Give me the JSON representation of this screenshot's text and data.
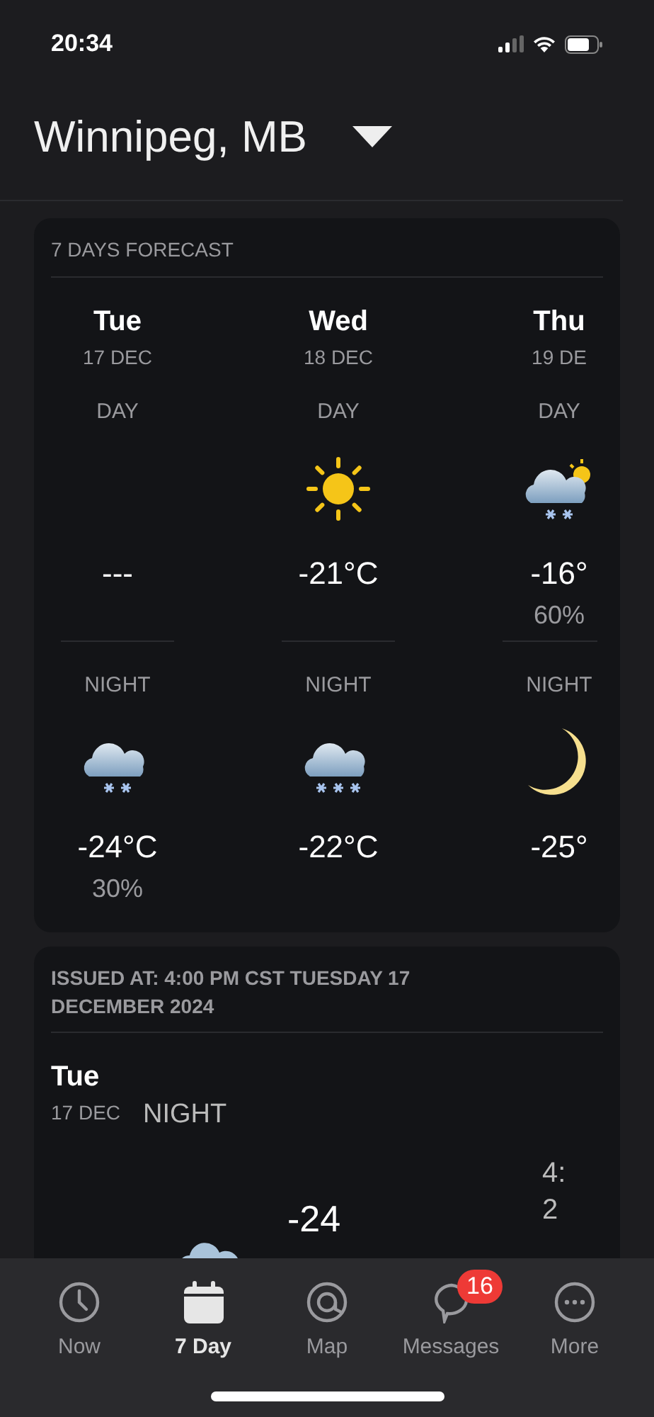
{
  "status_bar": {
    "time": "20:34"
  },
  "location": {
    "name": "Winnipeg, MB"
  },
  "forecast": {
    "title": "7 DAYS FORECAST",
    "days": [
      {
        "day": "Tue",
        "date": "17 DEC",
        "day_part": {
          "label": "DAY",
          "temp": "---"
        },
        "night_part": {
          "label": "NIGHT",
          "kind": "snow",
          "temp": "-24°C",
          "pop": "30%"
        }
      },
      {
        "day": "Wed",
        "date": "18 DEC",
        "day_part": {
          "label": "DAY",
          "kind": "sun",
          "temp": "-21°C"
        },
        "night_part": {
          "label": "NIGHT",
          "kind": "heavysnow",
          "temp": "-22°C"
        }
      },
      {
        "day": "Thu",
        "date": "19 DE",
        "day_part": {
          "label": "DAY",
          "kind": "snowsun",
          "temp": "-16°",
          "pop": "60%"
        },
        "night_part": {
          "label": "NIGHT",
          "kind": "moon",
          "temp": "-25°"
        }
      }
    ]
  },
  "detail": {
    "issued": "ISSUED AT: 4:00 PM CST TUESDAY 17 DECEMBER 2024",
    "day": "Tue",
    "date": "17 DEC",
    "period": "NIGHT",
    "temp": "-24",
    "side_lines": [
      "4:",
      "2"
    ]
  },
  "tabs": [
    {
      "label": "Now",
      "selected": false
    },
    {
      "label": "7 Day",
      "selected": true
    },
    {
      "label": "Map",
      "selected": false
    },
    {
      "label": "Messages",
      "selected": false,
      "badge": "16"
    },
    {
      "label": "More",
      "selected": false
    }
  ]
}
